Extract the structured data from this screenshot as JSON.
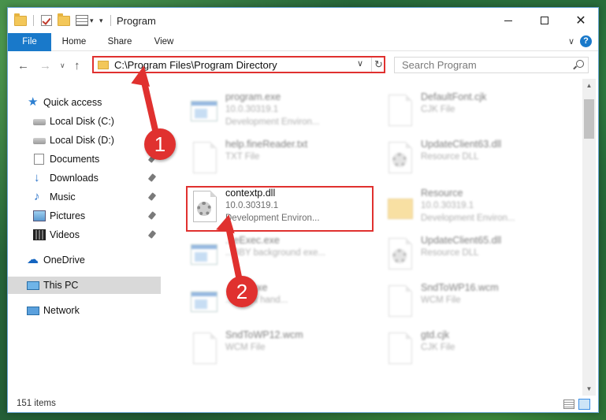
{
  "window": {
    "title": "Program"
  },
  "ribbon": {
    "tabs": [
      "File",
      "Home",
      "Share",
      "View"
    ],
    "help": "?"
  },
  "address": {
    "path": "C:\\Program Files\\Program Directory",
    "search_placeholder": "Search Program"
  },
  "sidebar": {
    "items": [
      {
        "label": "Quick access",
        "icon": "star-icon"
      },
      {
        "label": "Local Disk (C:)",
        "icon": "disk-icon"
      },
      {
        "label": "Local Disk (D:)",
        "icon": "disk-icon"
      },
      {
        "label": "Documents",
        "icon": "documents-icon",
        "pinned": true
      },
      {
        "label": "Downloads",
        "icon": "download-icon",
        "pinned": true
      },
      {
        "label": "Music",
        "icon": "music-icon",
        "pinned": true
      },
      {
        "label": "Pictures",
        "icon": "pictures-icon",
        "pinned": true
      },
      {
        "label": "Videos",
        "icon": "videos-icon",
        "pinned": true
      },
      {
        "label": "OneDrive",
        "icon": "cloud-icon"
      },
      {
        "label": "This PC",
        "icon": "pc-icon",
        "selected": true
      },
      {
        "label": "Network",
        "icon": "network-icon"
      }
    ]
  },
  "files": {
    "left": [
      {
        "name": "program.exe",
        "meta1": "10.0.30319.1",
        "meta2": "Development Environ...",
        "icon": "exe-icon"
      },
      {
        "name": "help.fineReader.txt",
        "meta1": "TXT File",
        "meta2": "",
        "icon": "document-icon"
      },
      {
        "name": "contextp.dll",
        "meta1": "10.0.30319.1",
        "meta2": "Development Environ...",
        "icon": "dll-gear-icon"
      },
      {
        "name": "...eExec.exe",
        "meta1": "...BBY background exe...",
        "meta2": "",
        "icon": "exe-icon"
      },
      {
        "name": "...STI.exe",
        "meta1": "... event hand...",
        "meta2": "",
        "icon": "exe-icon"
      },
      {
        "name": "SndToWP12.wcm",
        "meta1": "WCM File",
        "meta2": "",
        "icon": "document-icon"
      }
    ],
    "right": [
      {
        "name": "DefaultFont.cjk",
        "meta1": "CJK File",
        "meta2": "",
        "icon": "document-icon"
      },
      {
        "name": "UpdateClient63.dll",
        "meta1": "Resource DLL",
        "meta2": "",
        "icon": "dll-gear-icon"
      },
      {
        "name": "Resource",
        "meta1": "10.0.30319.1",
        "meta2": "Development Environ...",
        "icon": "folder-icon"
      },
      {
        "name": "UpdateClient65.dll",
        "meta1": "Resource DLL",
        "meta2": "",
        "icon": "dll-gear-icon"
      },
      {
        "name": "SndToWP16.wcm",
        "meta1": "WCM File",
        "meta2": "",
        "icon": "document-icon"
      },
      {
        "name": "gtd.cjk",
        "meta1": "CJK File",
        "meta2": "",
        "icon": "document-icon"
      }
    ]
  },
  "status": {
    "items_count": "151 items"
  },
  "callouts": [
    "1",
    "2"
  ],
  "colors": {
    "accent": "#1979ca",
    "highlight": "#e0312f",
    "selected_bg": "#d9d9d9"
  }
}
